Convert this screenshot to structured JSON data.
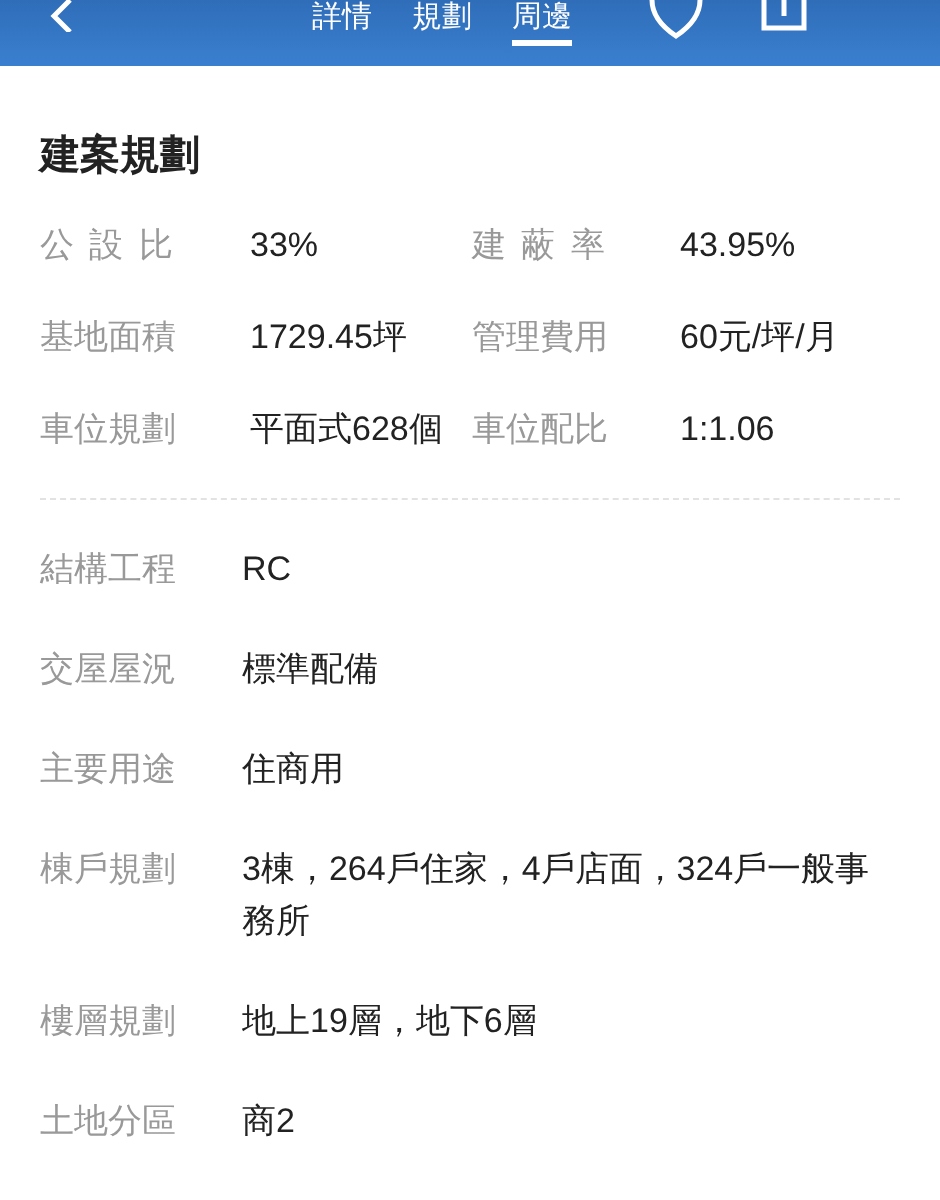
{
  "header": {
    "tabs": [
      {
        "label": "詳情",
        "selected": false
      },
      {
        "label": "規劃",
        "selected": false
      },
      {
        "label": "周邊",
        "selected": true
      }
    ]
  },
  "section": {
    "title": "建案規劃",
    "summary": [
      {
        "label": "公設比",
        "value": "33%",
        "spaced": true
      },
      {
        "label": "建蔽率",
        "value": "43.95%",
        "spaced": true
      },
      {
        "label": "基地面積",
        "value": "1729.45坪",
        "spaced": false
      },
      {
        "label": "管理費用",
        "value": "60元/坪/月",
        "spaced": false
      },
      {
        "label": "車位規劃",
        "value": "平面式628個",
        "spaced": false
      },
      {
        "label": "車位配比",
        "value": "1:1.06",
        "spaced": false
      }
    ],
    "details": [
      {
        "label": "結構工程",
        "value": "RC"
      },
      {
        "label": "交屋屋況",
        "value": "標準配備"
      },
      {
        "label": "主要用途",
        "value": "住商用"
      },
      {
        "label": "棟戶規劃",
        "value": "3棟，264戶住家，4戶店面，324戶一般事務所"
      },
      {
        "label": "樓層規劃",
        "value": "地上19層，地下6層"
      },
      {
        "label": "土地分區",
        "value": "商2"
      }
    ]
  }
}
